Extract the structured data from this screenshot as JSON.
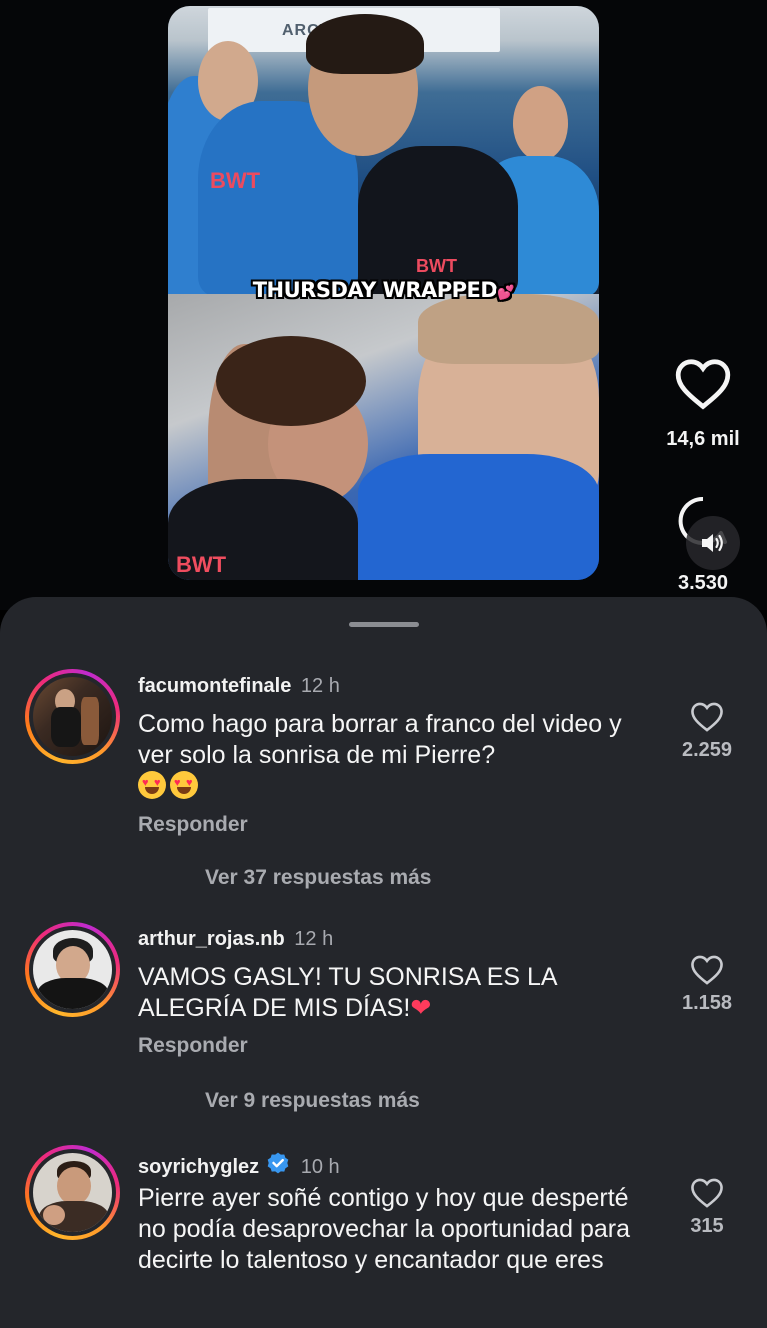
{
  "video": {
    "overlay_title": "THURSDAY WRAPPED",
    "banner_text": "ARCTIC WOLF",
    "brand_text_1": "BWT",
    "brand_text_2": "BWT",
    "brand_text_3": "BWT"
  },
  "actions": {
    "likes": "14,6 mil",
    "comments": "3.530"
  },
  "comments": [
    {
      "username": "facumontefinale",
      "time": "12 h",
      "verified": false,
      "text": "Como hago para borrar a franco del video y ver solo la sonrisa de mi Pierre?",
      "emoji": "😍😍",
      "likes": "2.259",
      "reply_label": "Responder",
      "more_replies": "Ver 37 respuestas más"
    },
    {
      "username": "arthur_rojas.nb",
      "time": "12 h",
      "verified": false,
      "text": "VAMOS GASLY! TU SONRISA ES LA ALEGRÍA DE MIS DÍAS!",
      "emoji": "❤️",
      "likes": "1.158",
      "reply_label": "Responder",
      "more_replies": "Ver 9 respuestas más"
    },
    {
      "username": "soyrichyglez",
      "time": "10 h",
      "verified": true,
      "text": "Pierre ayer soñé contigo y hoy que desperté no podía desaprovechar la oportunidad para decirte lo talentoso y encantador que eres",
      "likes": "315"
    }
  ],
  "colors": {
    "sheet_bg": "#24262b",
    "text_primary": "#f5f5f5",
    "text_secondary": "#a9abb0",
    "story_ring": [
      "#ffb52b",
      "#ee2a7b",
      "#c02bd0"
    ],
    "verified_blue": "#3897f0"
  },
  "icons": [
    "heart-icon",
    "comment-icon",
    "volume-icon",
    "verified-icon"
  ]
}
